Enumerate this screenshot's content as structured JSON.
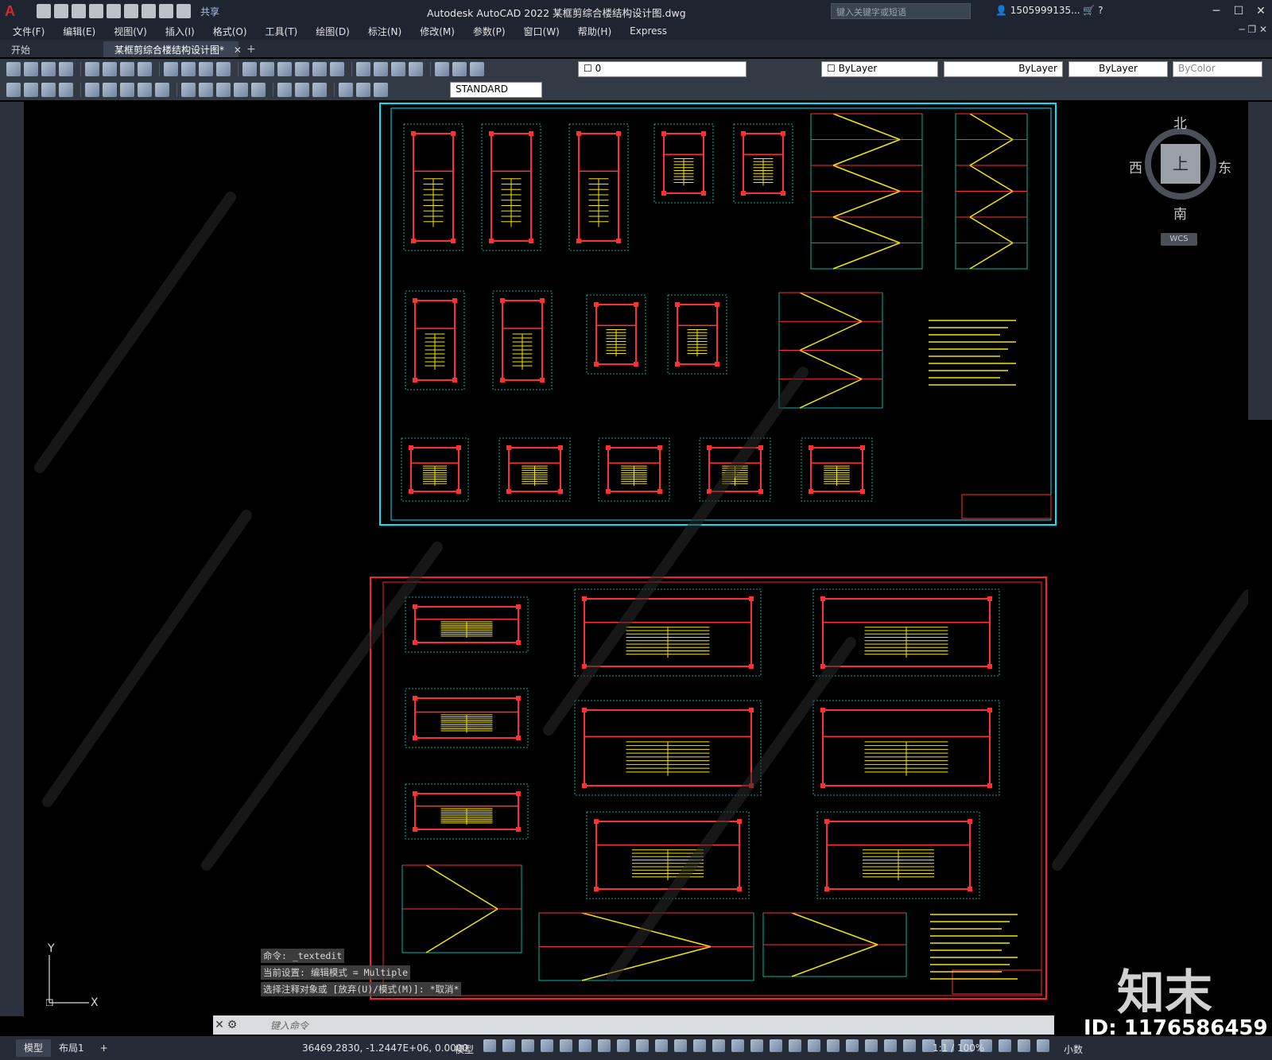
{
  "titlebar": {
    "logo": "A",
    "share": "共享",
    "title": "Autodesk AutoCAD 2022    某框剪综合楼结构设计图.dwg",
    "search_placeholder": "键入关键字或短语",
    "user": "1505999135..."
  },
  "menu": [
    "文件(F)",
    "编辑(E)",
    "视图(V)",
    "插入(I)",
    "格式(O)",
    "工具(T)",
    "绘图(D)",
    "标注(N)",
    "修改(M)",
    "参数(P)",
    "窗口(W)",
    "帮助(H)",
    "Express"
  ],
  "tabs": {
    "start": "开始",
    "active": "某框剪综合楼结构设计图*"
  },
  "properties": {
    "layer": "0",
    "color": "ByLayer",
    "linetype": "ByLayer",
    "lineweight": "ByLayer",
    "plotstyle": "ByColor",
    "text_style": "STANDARD"
  },
  "viewcube": {
    "north": "北",
    "south": "南",
    "east": "东",
    "west": "西",
    "top": "上",
    "wcs": "WCS"
  },
  "ucs": {
    "x": "X",
    "y": "Y"
  },
  "command": {
    "history": [
      "命令: _textedit",
      "当前设置: 编辑模式 = Multiple",
      "选择注释对象或 [放弃(U)/模式(M)]: *取消*"
    ],
    "prompt": "键入命令"
  },
  "status": {
    "layout_tabs": [
      "模型",
      "布局1"
    ],
    "coords": "36469.2830, -1.2447E+06, 0.0000",
    "model": "模型",
    "scale": "1:1 / 100%",
    "units": "小数"
  },
  "watermark": {
    "logo": "知末",
    "id": "ID: 1176586459"
  },
  "colors": {
    "sheet1_frame": "#00e5ff",
    "sheet2_frame": "#ff2020",
    "beam": "#ff3030",
    "stair": "#f5e600",
    "dimension": "#00e5d0"
  }
}
